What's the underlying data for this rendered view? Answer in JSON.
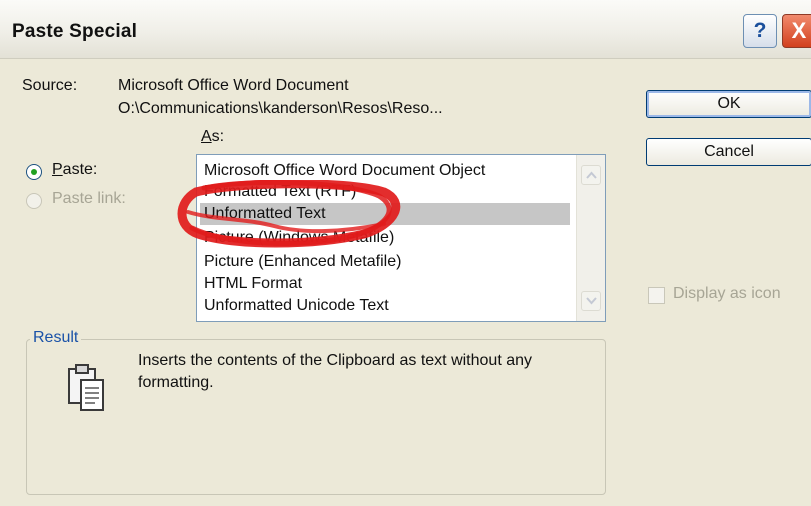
{
  "window": {
    "title": "Paste Special",
    "help_label": "?",
    "close_label": "X"
  },
  "source": {
    "label": "Source:",
    "line1": "Microsoft Office Word Document",
    "line2": "O:\\Communications\\kanderson\\Resos\\Reso..."
  },
  "as_label": "As:",
  "options": {
    "paste_label": "Paste:",
    "paste_selected": true,
    "paste_link_label": "Paste link:",
    "paste_link_enabled": false
  },
  "list": {
    "items": [
      "Microsoft Office Word Document Object",
      "Formatted Text (RTF)",
      "Unformatted Text",
      "Picture (Windows Metafile)",
      "Picture (Enhanced Metafile)",
      "HTML Format",
      "Unformatted Unicode Text"
    ],
    "selected_index": 2
  },
  "buttons": {
    "ok": "OK",
    "cancel": "Cancel"
  },
  "display_as_icon": {
    "label": "Display as icon",
    "checked": false,
    "enabled": false
  },
  "result": {
    "legend": "Result",
    "text": "Inserts the contents of the Clipboard as text without any formatting.",
    "icon": "clipboard-paste-icon"
  },
  "annotation": {
    "color": "#e11b1b"
  }
}
